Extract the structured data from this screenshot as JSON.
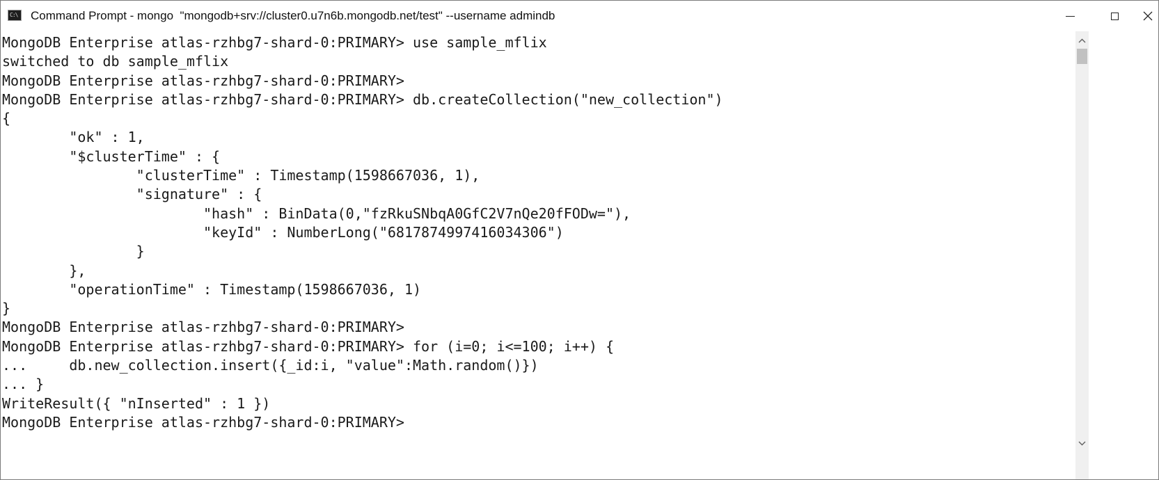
{
  "window": {
    "title": "Command Prompt - mongo  \"mongodb+srv://cluster0.u7n6b.mongodb.net/test\" --username admindb",
    "app_icon_glyph": "C:\\",
    "controls": {
      "minimize_icon": "minimize-icon",
      "maximize_icon": "maximize-icon",
      "close_icon": "close-icon"
    }
  },
  "console": {
    "lines": [
      "MongoDB Enterprise atlas-rzhbg7-shard-0:PRIMARY> use sample_mflix",
      "switched to db sample_mflix",
      "MongoDB Enterprise atlas-rzhbg7-shard-0:PRIMARY>",
      "MongoDB Enterprise atlas-rzhbg7-shard-0:PRIMARY> db.createCollection(\"new_collection\")",
      "{",
      "        \"ok\" : 1,",
      "        \"$clusterTime\" : {",
      "                \"clusterTime\" : Timestamp(1598667036, 1),",
      "                \"signature\" : {",
      "                        \"hash\" : BinData(0,\"fzRkuSNbqA0GfC2V7nQe20fFODw=\"),",
      "                        \"keyId\" : NumberLong(\"6817874997416034306\")",
      "                }",
      "        },",
      "        \"operationTime\" : Timestamp(1598667036, 1)",
      "}",
      "MongoDB Enterprise atlas-rzhbg7-shard-0:PRIMARY>",
      "MongoDB Enterprise atlas-rzhbg7-shard-0:PRIMARY> for (i=0; i<=100; i++) {",
      "...     db.new_collection.insert({_id:i, \"value\":Math.random()})",
      "... }",
      "WriteResult({ \"nInserted\" : 1 })",
      "MongoDB Enterprise atlas-rzhbg7-shard-0:PRIMARY>"
    ]
  },
  "scrollbar": {
    "up_icon": "scroll-up-arrow-icon",
    "down_icon": "scroll-down-arrow-icon"
  },
  "colors": {
    "text": "#1a1a1a",
    "background": "#ffffff",
    "scrollbar_track": "#f0f0f0",
    "scrollbar_thumb": "#c1c1c1"
  }
}
